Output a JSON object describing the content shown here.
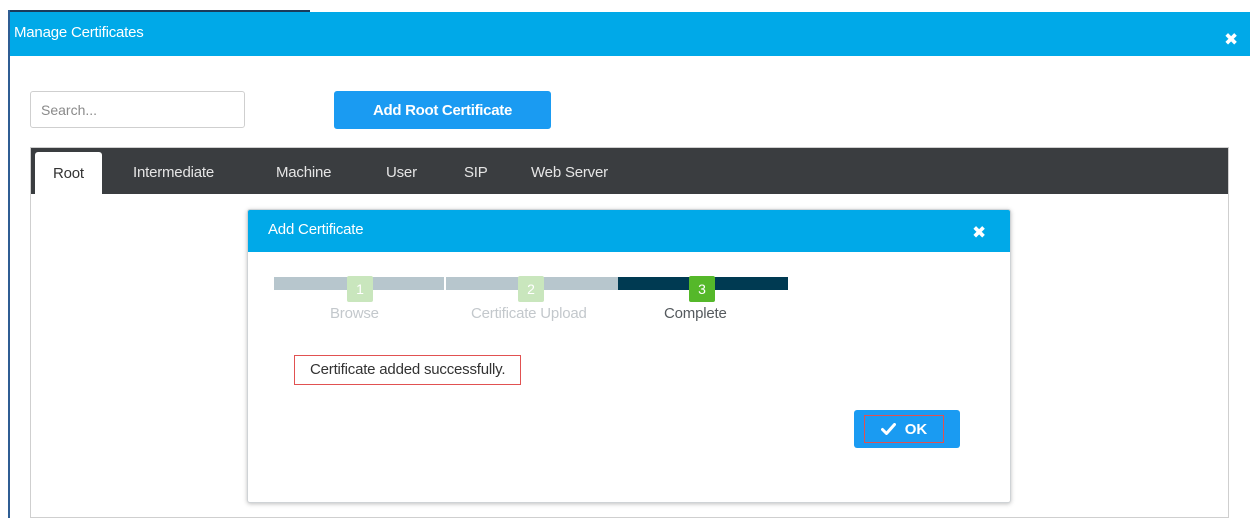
{
  "window": {
    "title": "Manage Certificates",
    "close_icon": "close-icon"
  },
  "toolbar": {
    "search_placeholder": "Search...",
    "add_root_label": "Add Root Certificate"
  },
  "tabs": [
    {
      "label": "Root",
      "active": true
    },
    {
      "label": "Intermediate",
      "active": false
    },
    {
      "label": "Machine",
      "active": false
    },
    {
      "label": "User",
      "active": false
    },
    {
      "label": "SIP",
      "active": false
    },
    {
      "label": "Web Server",
      "active": false
    }
  ],
  "modal": {
    "title": "Add Certificate",
    "close_icon": "close-icon",
    "steps": [
      {
        "number": "1",
        "label": "Browse",
        "state": "done"
      },
      {
        "number": "2",
        "label": "Certificate Upload",
        "state": "done"
      },
      {
        "number": "3",
        "label": "Complete",
        "state": "current"
      }
    ],
    "message": "Certificate added successfully.",
    "ok_label": "OK",
    "ok_icon": "check-icon"
  },
  "colors": {
    "header_blue": "#00a9e8",
    "button_blue": "#1a9bf2",
    "tabbar_dark": "#3a3d40",
    "step_done_bar": "#b7c6cd",
    "step_done_badge": "#c9e6bd",
    "step_current_bar": "#003a52",
    "step_current_badge": "#55b82a",
    "highlight_red": "#e15151"
  }
}
